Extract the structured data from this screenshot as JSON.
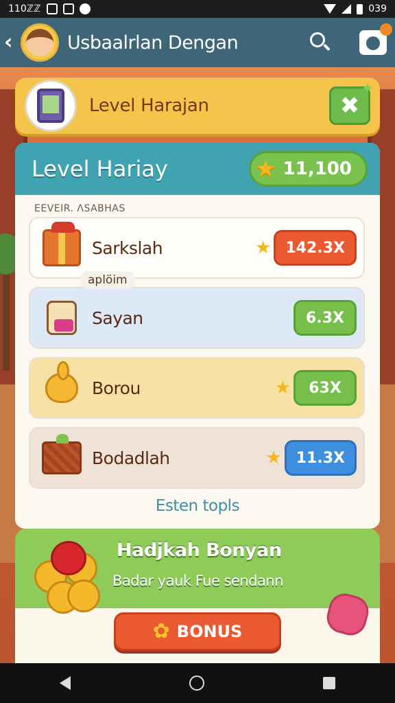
{
  "status": {
    "time": "110ℤℤ",
    "battery_text": "039"
  },
  "appbar": {
    "title": "Usbaalrlan Dengan"
  },
  "level_card": {
    "title": "Level Harajan"
  },
  "panel": {
    "title": "Level Hariay",
    "score": "11,100",
    "section_label": "EEVEIR. ΛSABHAS",
    "mid_chip": "aplöim",
    "footer_link": "Esten topls",
    "rows": [
      {
        "name": "Sarkslah",
        "multiplier": "142.3X"
      },
      {
        "name": "Sayan",
        "multiplier": "6.3X"
      },
      {
        "name": "Borou",
        "multiplier": "63X"
      },
      {
        "name": "Bodadlah",
        "multiplier": "11.3X"
      }
    ]
  },
  "bonus": {
    "title": "Hadjkah Bonyan",
    "subtitle": "Badar yauk Fue sendann",
    "button_label": "BONUS"
  }
}
